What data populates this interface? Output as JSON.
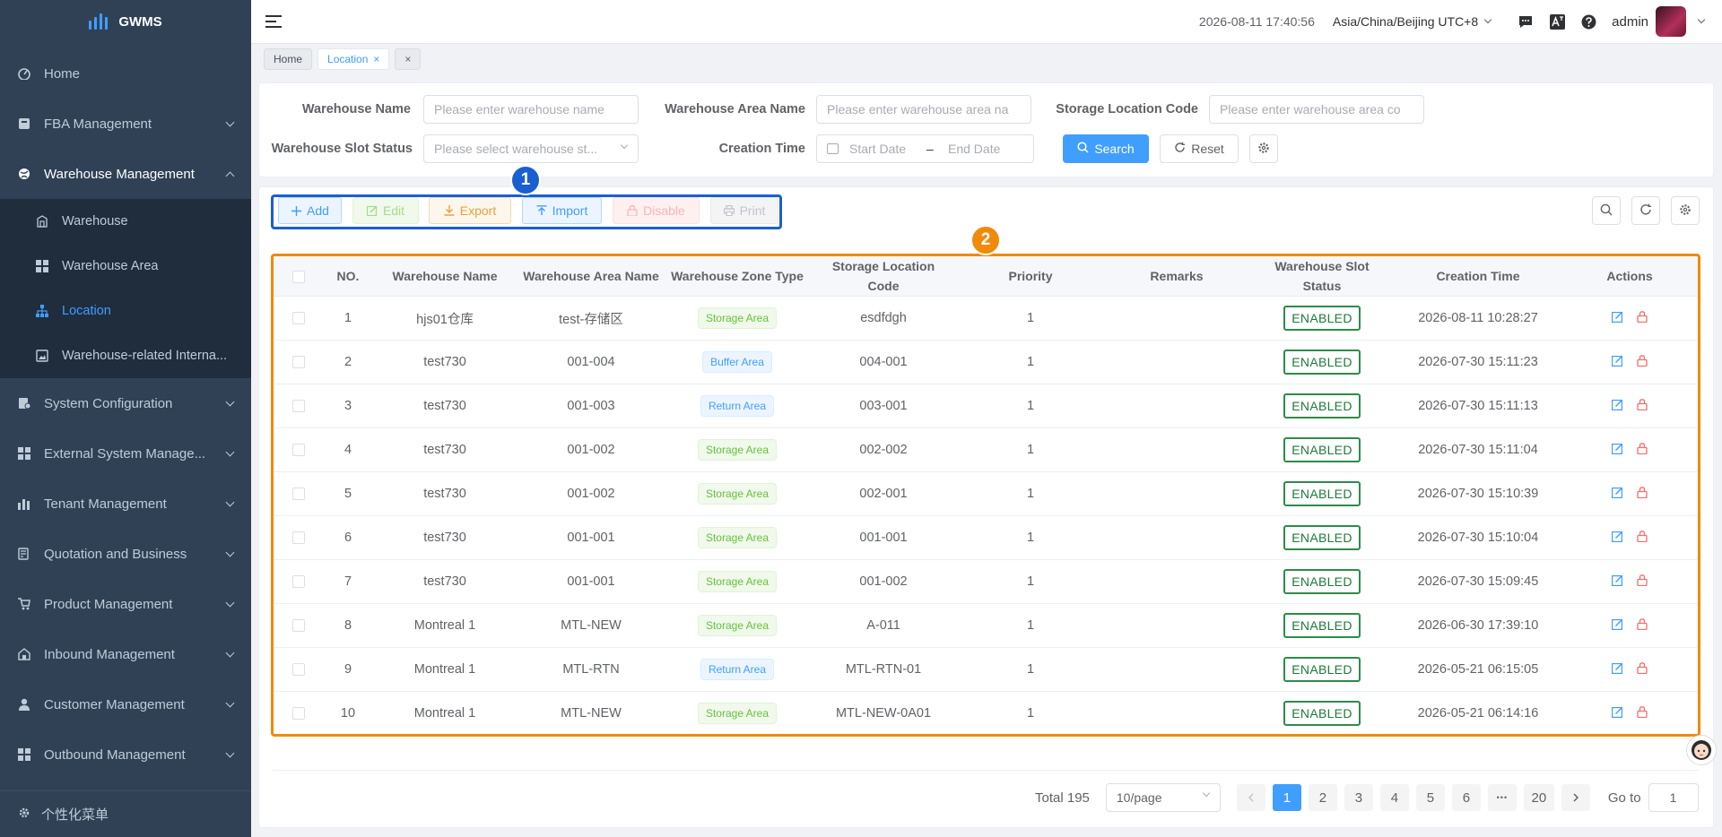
{
  "app": {
    "name": "GWMS"
  },
  "sidebar": {
    "items": [
      {
        "label": "Home",
        "icon": "dashboard-icon"
      },
      {
        "label": "FBA Management",
        "icon": "fba-icon"
      },
      {
        "label": "Warehouse Management",
        "icon": "globe-icon"
      },
      {
        "label": "System Configuration",
        "icon": "config-icon"
      },
      {
        "label": "External System Manage...",
        "icon": "external-system-icon"
      },
      {
        "label": "Tenant Management",
        "icon": "tenant-icon"
      },
      {
        "label": "Quotation and Business",
        "icon": "quotation-icon"
      },
      {
        "label": "Product Management",
        "icon": "cart-icon"
      },
      {
        "label": "Inbound Management",
        "icon": "inbound-icon"
      },
      {
        "label": "Customer Management",
        "icon": "user-icon"
      },
      {
        "label": "Outbound Management",
        "icon": "outbound-icon"
      }
    ],
    "submenu": [
      {
        "label": "Warehouse",
        "icon": "warehouse-icon"
      },
      {
        "label": "Warehouse Area",
        "icon": "grid-icon"
      },
      {
        "label": "Location",
        "icon": "location-tree-icon"
      },
      {
        "label": "Warehouse-related Interna...",
        "icon": "image-icon"
      }
    ],
    "footer": "个性化菜单"
  },
  "header": {
    "datetime": "2026-08-11 17:40:56",
    "timezone": "Asia/China/Beijing UTC+8",
    "username": "admin"
  },
  "tags": {
    "home": "Home",
    "location": "Location",
    "close": "×"
  },
  "search": {
    "warehouse_name_label": "Warehouse Name",
    "warehouse_name_placeholder": "Please enter warehouse name",
    "area_name_label": "Warehouse Area Name",
    "area_name_placeholder": "Please enter warehouse area na",
    "location_code_label": "Storage Location Code",
    "location_code_placeholder": "Please enter warehouse area co",
    "slot_status_label": "Warehouse Slot Status",
    "slot_status_placeholder": "Please select warehouse st...",
    "creation_time_label": "Creation Time",
    "start_date": "Start Date",
    "date_sep": "–",
    "end_date": "End Date",
    "search_btn": "Search",
    "reset_btn": "Reset"
  },
  "toolbar": {
    "add": "Add",
    "edit": "Edit",
    "export": "Export",
    "import": "Import",
    "disable": "Disable",
    "print": "Print"
  },
  "callouts": {
    "one": "1",
    "two": "2"
  },
  "table": {
    "columns": {
      "no": "NO.",
      "warehouse_name": "Warehouse Name",
      "area_name": "Warehouse Area Name",
      "zone_type": "Warehouse Zone Type",
      "location_code": "Storage Location Code",
      "priority": "Priority",
      "remarks": "Remarks",
      "slot_status": "Warehouse Slot Status",
      "creation_time": "Creation Time",
      "actions": "Actions"
    },
    "rows": [
      {
        "no": "1",
        "warehouse": "hjs01仓库",
        "area": "test-存储区",
        "zone": "Storage Area",
        "zone_kind": "storage",
        "code": "esdfdgh",
        "priority": "1",
        "remarks": "",
        "status": "ENABLED",
        "created": "2026-08-11 10:28:27"
      },
      {
        "no": "2",
        "warehouse": "test730",
        "area": "001-004",
        "zone": "Buffer Area",
        "zone_kind": "buffer",
        "code": "004-001",
        "priority": "1",
        "remarks": "",
        "status": "ENABLED",
        "created": "2026-07-30 15:11:23"
      },
      {
        "no": "3",
        "warehouse": "test730",
        "area": "001-003",
        "zone": "Return Area",
        "zone_kind": "return",
        "code": "003-001",
        "priority": "1",
        "remarks": "",
        "status": "ENABLED",
        "created": "2026-07-30 15:11:13"
      },
      {
        "no": "4",
        "warehouse": "test730",
        "area": "001-002",
        "zone": "Storage Area",
        "zone_kind": "storage",
        "code": "002-002",
        "priority": "1",
        "remarks": "",
        "status": "ENABLED",
        "created": "2026-07-30 15:11:04"
      },
      {
        "no": "5",
        "warehouse": "test730",
        "area": "001-002",
        "zone": "Storage Area",
        "zone_kind": "storage",
        "code": "002-001",
        "priority": "1",
        "remarks": "",
        "status": "ENABLED",
        "created": "2026-07-30 15:10:39"
      },
      {
        "no": "6",
        "warehouse": "test730",
        "area": "001-001",
        "zone": "Storage Area",
        "zone_kind": "storage",
        "code": "001-001",
        "priority": "1",
        "remarks": "",
        "status": "ENABLED",
        "created": "2026-07-30 15:10:04"
      },
      {
        "no": "7",
        "warehouse": "test730",
        "area": "001-001",
        "zone": "Storage Area",
        "zone_kind": "storage",
        "code": "001-002",
        "priority": "1",
        "remarks": "",
        "status": "ENABLED",
        "created": "2026-07-30 15:09:45"
      },
      {
        "no": "8",
        "warehouse": "Montreal 1",
        "area": "MTL-NEW",
        "zone": "Storage Area",
        "zone_kind": "storage",
        "code": "A-011",
        "priority": "1",
        "remarks": "",
        "status": "ENABLED",
        "created": "2026-06-30 17:39:10"
      },
      {
        "no": "9",
        "warehouse": "Montreal 1",
        "area": "MTL-RTN",
        "zone": "Return Area",
        "zone_kind": "return",
        "code": "MTL-RTN-01",
        "priority": "1",
        "remarks": "",
        "status": "ENABLED",
        "created": "2026-05-21 06:15:05"
      },
      {
        "no": "10",
        "warehouse": "Montreal 1",
        "area": "MTL-NEW",
        "zone": "Storage Area",
        "zone_kind": "storage",
        "code": "MTL-NEW-0A01",
        "priority": "1",
        "remarks": "",
        "status": "ENABLED",
        "created": "2026-05-21 06:14:16"
      }
    ]
  },
  "pagination": {
    "total": "Total 195",
    "page_size": "10/page",
    "pages": [
      "1",
      "2",
      "3",
      "4",
      "5",
      "6"
    ],
    "ellipsis": "•••",
    "last": "20",
    "goto_label": "Go to",
    "goto_value": "1",
    "current": "1"
  },
  "colors": {
    "accent": "#409eff",
    "sidebar_bg": "#304156",
    "callout_blue": "#1a5fd1",
    "callout_orange": "#f08a0b",
    "enabled_green": "#2e8b4a"
  }
}
